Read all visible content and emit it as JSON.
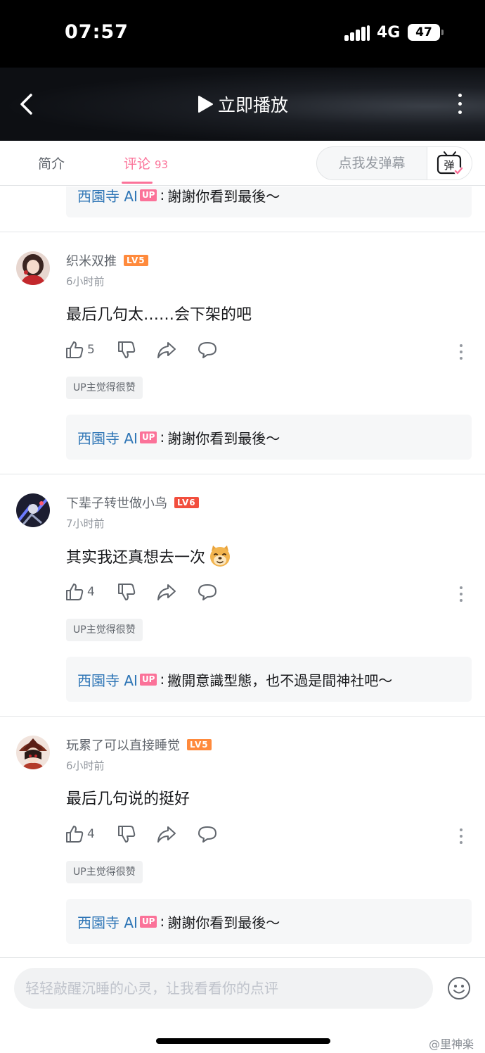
{
  "status_bar": {
    "time": "07:57",
    "network": "4G",
    "battery": "47"
  },
  "header": {
    "play_label": "立即播放"
  },
  "tabs": {
    "intro_label": "简介",
    "comments_label": "评论",
    "comments_count": "93",
    "danmaku_placeholder": "点我发弹幕",
    "danmaku_toggle_glyph": "弹"
  },
  "top_reply": {
    "name": "西園寺 AI",
    "badge": "UP",
    "colon": ":",
    "text": "謝謝你看到最後～"
  },
  "comments": [
    {
      "username": "织米双推",
      "level": "LV5",
      "time": "6小时前",
      "text": "最后几句太……会下架的吧",
      "likes": "5",
      "up_liked": "UP主觉得很赞",
      "reply": {
        "name": "西園寺 AI",
        "badge": "UP",
        "colon": ":",
        "text": "謝謝你看到最後～"
      }
    },
    {
      "username": "下辈子转世做小鸟",
      "level": "LV6",
      "time": "7小时前",
      "text": "其实我还真想去一次",
      "emoji": "doge-emoji",
      "likes": "4",
      "up_liked": "UP主觉得很赞",
      "reply": {
        "name": "西園寺 AI",
        "badge": "UP",
        "colon": ":",
        "text": "撇開意識型態，也不過是間神社吧～"
      }
    },
    {
      "username": "玩累了可以直接睡觉",
      "level": "LV5",
      "time": "6小时前",
      "text": "最后几句说的挺好",
      "likes": "4",
      "up_liked": "UP主觉得很赞",
      "reply": {
        "name": "西園寺 AI",
        "badge": "UP",
        "colon": ":",
        "text": "謝謝你看到最後～"
      }
    }
  ],
  "input": {
    "placeholder": "轻轻敲醒沉睡的心灵，让我看看你的点评"
  },
  "watermark": "@里神楽",
  "colors": {
    "accent": "#fb7299",
    "reply_name": "#2f76b6",
    "lv5": "#ff8a3c",
    "lv6": "#f24e3d"
  },
  "icons": [
    "back-icon",
    "play-icon",
    "more-icon",
    "danmaku-toggle-icon",
    "like-icon",
    "dislike-icon",
    "share-icon",
    "reply-icon",
    "emoji-icon"
  ]
}
